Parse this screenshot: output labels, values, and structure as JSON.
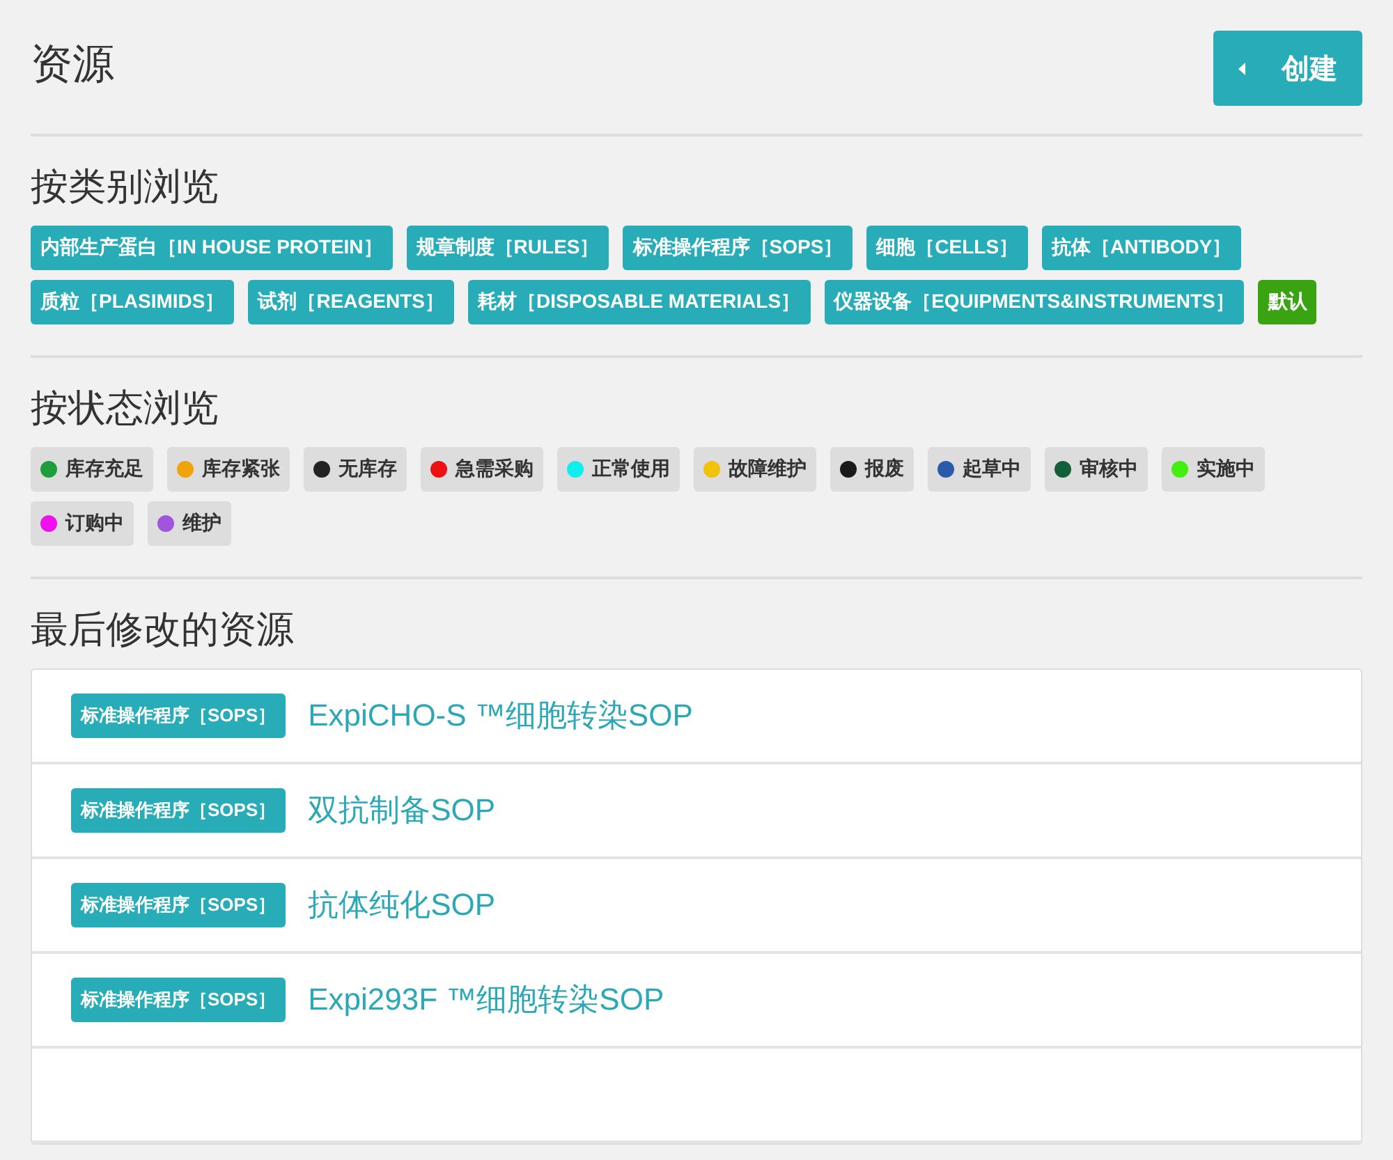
{
  "header": {
    "title": "资源",
    "create_button": "创建"
  },
  "categories": {
    "title": "按类别浏览",
    "tags": [
      {
        "label": "内部生产蛋白［IN HOUSE PROTEIN］",
        "kind": "category"
      },
      {
        "label": "规章制度［RULES］",
        "kind": "category"
      },
      {
        "label": "标准操作程序［SOPS］",
        "kind": "category"
      },
      {
        "label": "细胞［CELLS］",
        "kind": "category"
      },
      {
        "label": "抗体［ANTIBODY］",
        "kind": "category"
      },
      {
        "label": "质粒［PLASIMIDS］",
        "kind": "category"
      },
      {
        "label": "试剂［REAGENTS］",
        "kind": "category"
      },
      {
        "label": "耗材［DISPOSABLE MATERIALS］",
        "kind": "category"
      },
      {
        "label": "仪器设备［EQUIPMENTS&INSTRUMENTS］",
        "kind": "category"
      },
      {
        "label": "默认",
        "kind": "default"
      }
    ]
  },
  "statuses": {
    "title": "按状态浏览",
    "tags": [
      {
        "label": "库存充足",
        "color": "#1e9e3a"
      },
      {
        "label": "库存紧张",
        "color": "#f0a30a"
      },
      {
        "label": "无库存",
        "color": "#222222"
      },
      {
        "label": "急需采购",
        "color": "#ee1111"
      },
      {
        "label": "正常使用",
        "color": "#11eeee"
      },
      {
        "label": "故障维护",
        "color": "#f0c30a"
      },
      {
        "label": "报废",
        "color": "#1a1a1a"
      },
      {
        "label": "起草中",
        "color": "#2a5aa8"
      },
      {
        "label": "审核中",
        "color": "#11603a"
      },
      {
        "label": "实施中",
        "color": "#44ee11"
      },
      {
        "label": "订购中",
        "color": "#ee11ee"
      },
      {
        "label": "维护",
        "color": "#a055dd"
      }
    ]
  },
  "recent": {
    "title": "最后修改的资源",
    "items": [
      {
        "tag": "标准操作程序［SOPS］",
        "name": "ExpiCHO-S ™细胞转染SOP"
      },
      {
        "tag": "标准操作程序［SOPS］",
        "name": "双抗制备SOP"
      },
      {
        "tag": "标准操作程序［SOPS］",
        "name": "抗体纯化SOP"
      },
      {
        "tag": "标准操作程序［SOPS］",
        "name": "Expi293F ™细胞转染SOP"
      }
    ]
  }
}
